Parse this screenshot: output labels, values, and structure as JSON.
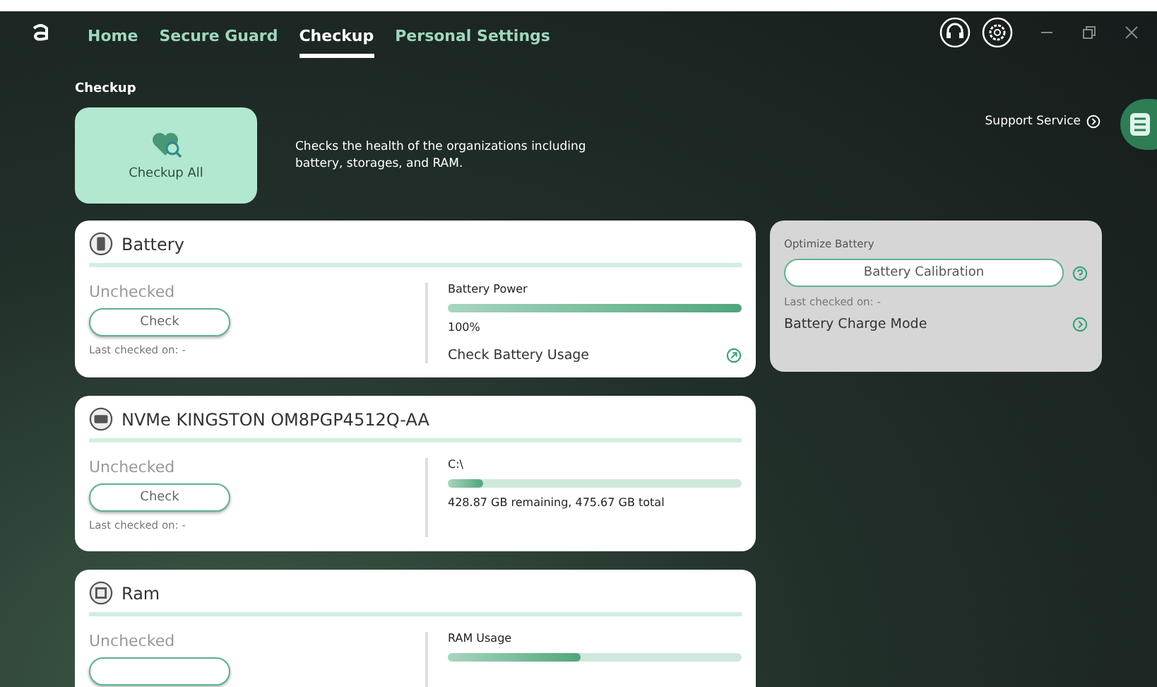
{
  "nav": {
    "tabs": [
      {
        "label": "Home",
        "selected": false
      },
      {
        "label": "Secure Guard",
        "selected": false
      },
      {
        "label": "Checkup",
        "selected": true
      },
      {
        "label": "Personal Settings",
        "selected": false
      }
    ]
  },
  "section_title": "Checkup",
  "checkup_all": {
    "label": "Checkup All",
    "description": "Checks the health of the organizations including battery, storages, and RAM."
  },
  "support_link": "Support Service",
  "cards": [
    {
      "kind": "battery",
      "title": "Battery",
      "status": "Unchecked",
      "button": "Check",
      "last_checked": "Last checked on: -",
      "meter_label": "Battery Power",
      "level": 1,
      "reading": "100%",
      "link": "Check Battery Usage"
    },
    {
      "kind": "storage",
      "title": "NVMe KINGSTON OM8PGP4512Q-AA",
      "status": "Unchecked",
      "button": "Check",
      "last_checked": "Last checked on: -",
      "meter_label": "C:\\",
      "level": 0.12,
      "reading": "428.87 GB remaining, 475.67 GB total"
    },
    {
      "kind": "ram",
      "title": "Ram",
      "status": "Unchecked",
      "meter_label": "RAM Usage",
      "level": 0.45
    }
  ],
  "optimize": {
    "title": "Optimize Battery",
    "button": "Battery Calibration",
    "last_checked": "Last checked on: -",
    "link": "Battery Charge Mode"
  }
}
